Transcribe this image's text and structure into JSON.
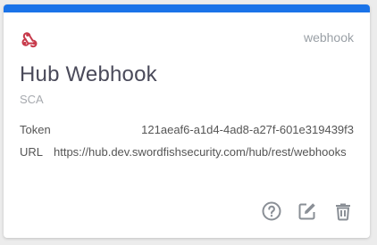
{
  "card": {
    "type_label": "webhook",
    "title": "Hub Webhook",
    "subtitle": "SCA",
    "token": {
      "label": "Token",
      "value": "121aeaf6-a1d4-4ad8-a27f-601e319439f3"
    },
    "url": {
      "label": "URL",
      "value": "https://hub.dev.swordfishsecurity.com/hub/rest/webhooks"
    },
    "icon": "webhook-icon",
    "actions": [
      {
        "name": "help",
        "icon": "help-circle-icon"
      },
      {
        "name": "edit",
        "icon": "edit-icon"
      },
      {
        "name": "delete",
        "icon": "trash-icon"
      }
    ]
  },
  "colors": {
    "accent": "#1a73e8",
    "webhook_icon": "#c73a4b",
    "action_icon": "#8a8f96"
  }
}
